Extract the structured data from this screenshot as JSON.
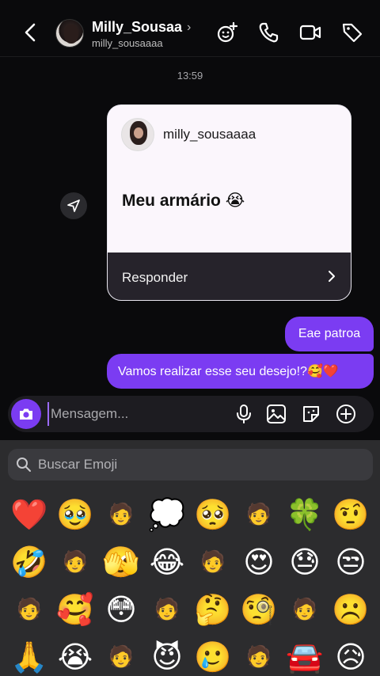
{
  "header": {
    "name": "Milly_Sousaa",
    "name_chevron": "›",
    "handle": "milly_sousaaaa"
  },
  "chat": {
    "timestamp": "13:59",
    "story_reply": {
      "username": "milly_sousaaaa",
      "text": "Meu armário 😭",
      "reply_label": "Responder"
    },
    "messages": [
      {
        "from": "me",
        "text": "Eae patroa"
      },
      {
        "from": "me",
        "text": "Vamos realizar esse seu desejo!?🥰❤️"
      }
    ],
    "bubble_color": "#7b3cf2"
  },
  "composer": {
    "placeholder": "Mensagem..."
  },
  "emoji_panel": {
    "search_placeholder": "Buscar Emoji",
    "emojis": [
      "❤️",
      "🥹",
      "🧑",
      "💭",
      "🥺",
      "🧑",
      "🍀",
      "🤨",
      "🤣",
      "🧑",
      "🫣",
      "😂",
      "🧑",
      "😍",
      "😓",
      "😒",
      "🧑",
      "🥰",
      "😳",
      "🧑",
      "🤔",
      "🧐",
      "🧑",
      "☹️",
      "🙏",
      "😭",
      "🧑",
      "😈",
      "🥲",
      "🧑",
      "🚘",
      "😥"
    ],
    "mini_indices": [
      2,
      5,
      9,
      12,
      16,
      19,
      22,
      26,
      29
    ]
  }
}
